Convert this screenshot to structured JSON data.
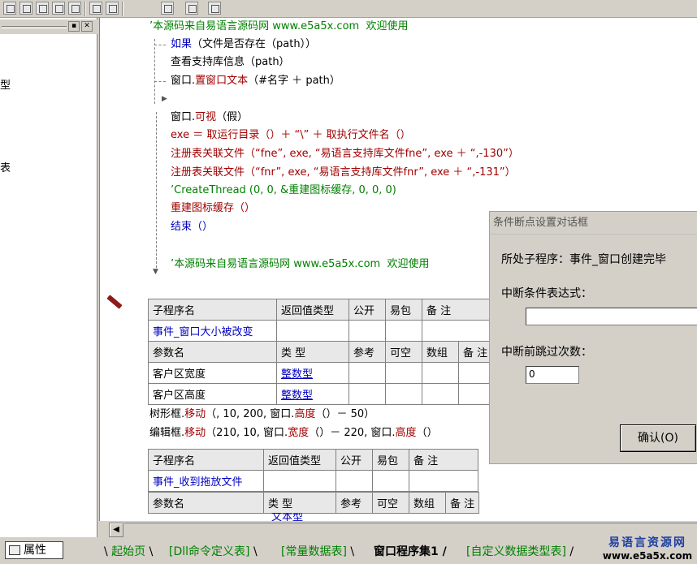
{
  "left_panel": {
    "frag_1": "型",
    "frag_2": "表",
    "props_tab": "属性"
  },
  "code_top": {
    "line1": "’本源码来自易语言源码网 www.e5a5x.com  欢迎使用",
    "if_kw": "如果",
    "if_rest": "（文件是否存在（path））",
    "line3": "查看支持库信息（path）",
    "line4_a": "窗口.",
    "line4_b": "置窗口文本",
    "line4_c": "（#名字 ＋ path）",
    "line5_a": "窗口.",
    "line5_b": "可视",
    "line5_c": "（假）",
    "line6": "exe ＝ 取运行目录（）＋ “\\” ＋ 取执行文件名（）",
    "line7_a": "注册表关联文件（“fne”, exe, “易语言支持库文件fne”, exe ＋ “,-130”）",
    "line8_a": "注册表关联文件（“fnr”, exe, “易语言支持库文件fnr”, exe ＋ “,-131”）",
    "line9": "’CreateThread (0, 0, &重建图标缓存, 0, 0, 0)",
    "line10": "重建图标缓存（）",
    "line11": "结束（）",
    "line12": "’本源码来自易语言源码网 www.e5a5x.com  欢迎使用"
  },
  "table1": {
    "headers": [
      "子程序名",
      "返回值类型",
      "公开",
      "易包",
      "备 注"
    ],
    "name": "事件_窗口大小被改变",
    "param_headers": [
      "参数名",
      "类 型",
      "参考",
      "可空",
      "数组",
      "备 注"
    ],
    "params": [
      {
        "name": "客户区宽度",
        "type": "整数型"
      },
      {
        "name": "客户区高度",
        "type": "整数型"
      }
    ]
  },
  "code_mid": {
    "line1_a": "树形框.",
    "line1_b": "移动",
    "line1_c": "（, 10, 200, 窗口.",
    "line1_d": "高度",
    "line1_e": "（）－ 50）",
    "line2_a": "编辑框.",
    "line2_b": "移动",
    "line2_c": "（210, 10, 窗口.",
    "line2_d": "宽度",
    "line2_e": "（）－ 220, 窗口.",
    "line2_f": "高度",
    "line2_g": "（）"
  },
  "table2": {
    "headers": [
      "子程序名",
      "返回值类型",
      "公开",
      "易包",
      "备 注"
    ],
    "name": "事件_收到拖放文件",
    "param_headers": [
      "参数名",
      "类 型",
      "参考",
      "可空",
      "数组",
      "备 注"
    ],
    "params": [
      {
        "name": "...",
        "type": "文本型"
      }
    ]
  },
  "dialog": {
    "title": "条件断点设置对话框",
    "subprogram_label": "所处子程序：事件_窗口创建完毕",
    "condition_label": "中断条件表达式：",
    "condition_value": "",
    "skip_label": "中断前跳过次数：",
    "skip_value": "0",
    "ok_button": "确认(O)"
  },
  "tabs": {
    "items": [
      "起始页",
      "[Dll命令定义表]",
      "[常量数据表]",
      "窗口程序集1",
      "[自定义数据类型表]"
    ],
    "active_index": 3
  },
  "logo": {
    "line1": "易语言资源网",
    "line2": "www.e5a5x.com"
  },
  "colors": {
    "comment": "#008000",
    "keyword": "#0000c0",
    "method": "#a00000",
    "chrome": "#d4d0c8"
  }
}
